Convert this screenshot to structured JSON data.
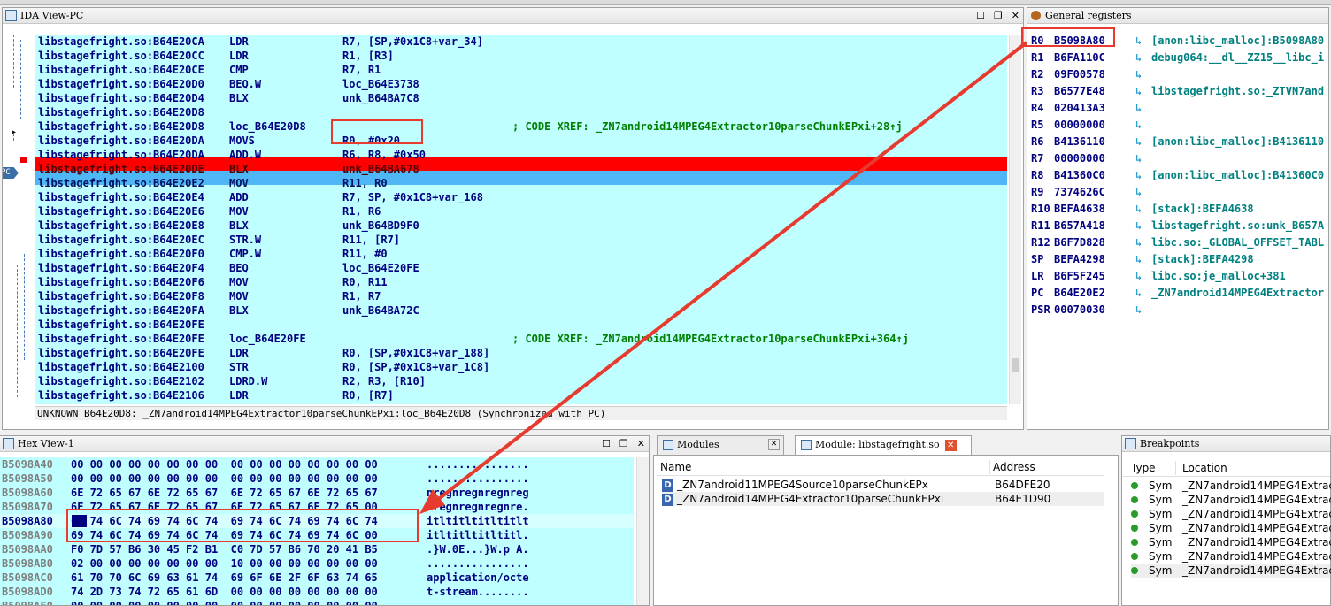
{
  "ida": {
    "title": "IDA View-PC",
    "status_prefix": "UNKNOWN",
    "status_text": "B64E20D8: _ZN7android14MPEG4Extractor10parseChunkEPxi:loc_B64E20D8 (Synchronized with PC)",
    "pc_marker": "PC",
    "lines": [
      {
        "addr": "libstagefright.so:B64E20CA",
        "mnem": "LDR",
        "ops": "R7, [SP,#0x1C8+var_34]",
        "cmt": ""
      },
      {
        "addr": "libstagefright.so:B64E20CC",
        "mnem": "LDR",
        "ops": "R1, [R3]",
        "cmt": ""
      },
      {
        "addr": "libstagefright.so:B64E20CE",
        "mnem": "CMP",
        "ops": "R7, R1",
        "cmt": ""
      },
      {
        "addr": "libstagefright.so:B64E20D0",
        "mnem": "BEQ.W",
        "ops": "loc_B64E3738",
        "cmt": ""
      },
      {
        "addr": "libstagefright.so:B64E20D4",
        "mnem": "BLX",
        "ops": "unk_B64BA7C8",
        "cmt": ""
      },
      {
        "addr": "libstagefright.so:B64E20D8",
        "mnem": "",
        "ops": "",
        "cmt": ""
      },
      {
        "addr": "libstagefright.so:B64E20D8",
        "mnem": "loc_B64E20D8",
        "ops": "",
        "cmt": "; CODE XREF: _ZN7android14MPEG4Extractor10parseChunkEPxi+28↑j"
      },
      {
        "addr": "libstagefright.so:B64E20DA",
        "mnem": "MOVS",
        "ops": "R0, #0x20",
        "cmt": ""
      },
      {
        "addr": "libstagefright.so:B64E20DA",
        "mnem": "ADD.W",
        "ops": "R6, R8, #0x50",
        "cmt": ""
      },
      {
        "addr": "libstagefright.so:B64E20DE",
        "mnem": "BLX",
        "ops": "unk_B64BA678",
        "cmt": ""
      },
      {
        "addr": "libstagefright.so:B64E20E2",
        "mnem": "MOV",
        "ops": "R11, R0",
        "cmt": ""
      },
      {
        "addr": "libstagefright.so:B64E20E4",
        "mnem": "ADD",
        "ops": "R7, SP, #0x1C8+var_168",
        "cmt": ""
      },
      {
        "addr": "libstagefright.so:B64E20E6",
        "mnem": "MOV",
        "ops": "R1, R6",
        "cmt": ""
      },
      {
        "addr": "libstagefright.so:B64E20E8",
        "mnem": "BLX",
        "ops": "unk_B64BD9F0",
        "cmt": ""
      },
      {
        "addr": "libstagefright.so:B64E20EC",
        "mnem": "STR.W",
        "ops": "R11, [R7]",
        "cmt": ""
      },
      {
        "addr": "libstagefright.so:B64E20F0",
        "mnem": "CMP.W",
        "ops": "R11, #0",
        "cmt": ""
      },
      {
        "addr": "libstagefright.so:B64E20F4",
        "mnem": "BEQ",
        "ops": "loc_B64E20FE",
        "cmt": ""
      },
      {
        "addr": "libstagefright.so:B64E20F6",
        "mnem": "MOV",
        "ops": "R0, R11",
        "cmt": ""
      },
      {
        "addr": "libstagefright.so:B64E20F8",
        "mnem": "MOV",
        "ops": "R1, R7",
        "cmt": ""
      },
      {
        "addr": "libstagefright.so:B64E20FA",
        "mnem": "BLX",
        "ops": "unk_B64BA72C",
        "cmt": ""
      },
      {
        "addr": "libstagefright.so:B64E20FE",
        "mnem": "",
        "ops": "",
        "cmt": ""
      },
      {
        "addr": "libstagefright.so:B64E20FE",
        "mnem": "loc_B64E20FE",
        "ops": "",
        "cmt": "; CODE XREF: _ZN7android14MPEG4Extractor10parseChunkEPxi+364↑j"
      },
      {
        "addr": "libstagefright.so:B64E20FE",
        "mnem": "LDR",
        "ops": "R0, [SP,#0x1C8+var_188]",
        "cmt": ""
      },
      {
        "addr": "libstagefright.so:B64E2100",
        "mnem": "STR",
        "ops": "R0, [SP,#0x1C8+var_1C8]",
        "cmt": ""
      },
      {
        "addr": "libstagefright.so:B64E2102",
        "mnem": "LDRD.W",
        "ops": "R2, R3, [R10]",
        "cmt": ""
      },
      {
        "addr": "libstagefright.so:B64E2106",
        "mnem": "LDR",
        "ops": "R0, [R7]",
        "cmt": ""
      }
    ]
  },
  "registers": {
    "title": "General registers",
    "rows": [
      {
        "name": "R0",
        "value": "B5098A80",
        "desc": "[anon:libc_malloc]:B5098A80"
      },
      {
        "name": "R1",
        "value": "B6FA110C",
        "desc": "debug064:__dl__ZZ15__libc_i"
      },
      {
        "name": "R2",
        "value": "09F00578",
        "desc": ""
      },
      {
        "name": "R3",
        "value": "B6577E48",
        "desc": "libstagefright.so:_ZTVN7and"
      },
      {
        "name": "R4",
        "value": "020413A3",
        "desc": ""
      },
      {
        "name": "R5",
        "value": "00000000",
        "desc": ""
      },
      {
        "name": "R6",
        "value": "B4136110",
        "desc": "[anon:libc_malloc]:B4136110"
      },
      {
        "name": "R7",
        "value": "00000000",
        "desc": ""
      },
      {
        "name": "R8",
        "value": "B41360C0",
        "desc": "[anon:libc_malloc]:B41360C0"
      },
      {
        "name": "R9",
        "value": "7374626C",
        "desc": ""
      },
      {
        "name": "R10",
        "value": "BEFA4638",
        "desc": "[stack]:BEFA4638"
      },
      {
        "name": "R11",
        "value": "B657A418",
        "desc": "libstagefright.so:unk_B657A"
      },
      {
        "name": "R12",
        "value": "B6F7D828",
        "desc": "libc.so:_GLOBAL_OFFSET_TABL"
      },
      {
        "name": "SP",
        "value": "BEFA4298",
        "desc": "[stack]:BEFA4298"
      },
      {
        "name": "LR",
        "value": "B6F5F245",
        "desc": "libc.so:je_malloc+381"
      },
      {
        "name": "PC",
        "value": "B64E20E2",
        "desc": "_ZN7android14MPEG4Extractor"
      },
      {
        "name": "PSR",
        "value": "00070030",
        "desc": ""
      }
    ]
  },
  "hex": {
    "title": "Hex View-1",
    "lines": [
      {
        "addr": "B5098A40",
        "bytes": "00 00 00 00 00 00 00 00  00 00 00 00 00 00 00 00",
        "ascii": "................"
      },
      {
        "addr": "B5098A50",
        "bytes": "00 00 00 00 00 00 00 00  00 00 00 00 00 00 00 00",
        "ascii": "................"
      },
      {
        "addr": "B5098A60",
        "bytes": "6E 72 65 67 6E 72 65 67  6E 72 65 67 6E 72 65 67",
        "ascii": "nregnregnregnreg"
      },
      {
        "addr": "B5098A70",
        "bytes": "6E 72 65 67 6E 72 65 67  6E 72 65 67 6E 72 65 00",
        "ascii": "nregnregnregnre."
      },
      {
        "addr": "B5098A80",
        "bytes": "69 74 6C 74 69 74 6C 74  69 74 6C 74 69 74 6C 74",
        "ascii": "itltitltitltitlt"
      },
      {
        "addr": "B5098A90",
        "bytes": "69 74 6C 74 69 74 6C 74  69 74 6C 74 69 74 6C 00",
        "ascii": "itltitltitltitl."
      },
      {
        "addr": "B5098AA0",
        "bytes": "F0 7D 57 B6 30 45 F2 B1  C0 7D 57 B6 70 20 41 B5",
        "ascii": ".}W.0E...}W.p A."
      },
      {
        "addr": "B5098AB0",
        "bytes": "02 00 00 00 00 00 00 00  10 00 00 00 00 00 00 00",
        "ascii": "................"
      },
      {
        "addr": "B5098AC0",
        "bytes": "61 70 70 6C 69 63 61 74  69 6F 6E 2F 6F 63 74 65",
        "ascii": "application/octe"
      },
      {
        "addr": "B5098AD0",
        "bytes": "74 2D 73 74 72 65 61 6D  00 00 00 00 00 00 00 00",
        "ascii": "t-stream........"
      },
      {
        "addr": "B5098AE0",
        "bytes": "00 00 00 00 00 00 00 00  00 00 00 00 00 00 00 00",
        "ascii": "................"
      }
    ]
  },
  "modules": {
    "tab_modules": "Modules",
    "tab_module": "Module: libstagefright.so",
    "col_name": "Name",
    "col_address": "Address",
    "rows": [
      {
        "icon": "D",
        "name": "_ZN7android11MPEG4Source10parseChunkEPx",
        "address": "B64DFE20"
      },
      {
        "icon": "D",
        "name": "_ZN7android14MPEG4Extractor10parseChunkEPxi",
        "address": "B64E1D90"
      }
    ]
  },
  "breakpoints": {
    "title": "Breakpoints",
    "col_type": "Type",
    "col_location": "Location",
    "rows": [
      {
        "type": "Sym",
        "location": "_ZN7android14MPEG4Extract"
      },
      {
        "type": "Sym",
        "location": "_ZN7android14MPEG4Extract"
      },
      {
        "type": "Sym",
        "location": "_ZN7android14MPEG4Extract"
      },
      {
        "type": "Sym",
        "location": "_ZN7android14MPEG4Extract"
      },
      {
        "type": "Sym",
        "location": "_ZN7android14MPEG4Extract"
      },
      {
        "type": "Sym",
        "location": "_ZN7android14MPEG4Extract"
      },
      {
        "type": "Sym",
        "location": "_ZN7android14MPEG4Extract"
      }
    ]
  },
  "colors": {
    "code_bg": "#c0ffff",
    "breakpoint_line": "#ff0000",
    "current_line": "#4fb7f5",
    "annotation": "#e63b2e"
  }
}
